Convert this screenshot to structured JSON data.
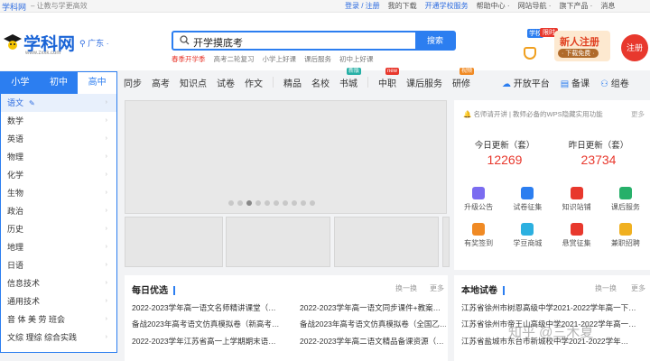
{
  "topbar": {
    "brand": "学科网",
    "slogan": "– 让教与学更高效",
    "links": [
      "登录 / 注册",
      "我的下载",
      "开通学校服务",
      "帮助中心 ·",
      "网站导航 ·",
      "旗下产品 ·",
      "消息"
    ]
  },
  "header": {
    "logo": {
      "name": "学科网",
      "sub": "www.zxxk.com"
    },
    "location": "广东 ·",
    "search": {
      "value": "开学摸底考",
      "button": "搜索"
    },
    "hotwords": [
      "春季开学季",
      "高考二轮复习",
      "小学上好课",
      "课后服务",
      "初中上好课"
    ],
    "promo": {
      "tag": "学校",
      "limited": "限时",
      "title": "新人注册",
      "subtitle": "· 下载免费 ·",
      "register": "注册"
    }
  },
  "stage_tabs": [
    "小学",
    "初中",
    "高中"
  ],
  "active_stage": "高中",
  "subjects": [
    "语文",
    "数学",
    "英语",
    "物理",
    "化学",
    "生物",
    "政治",
    "历史",
    "地理",
    "日语",
    "信息技术",
    "通用技术",
    "音 体 美 劳 班会",
    "文综 理综 综合实践"
  ],
  "nav": {
    "items": [
      {
        "label": "同步"
      },
      {
        "label": "高考"
      },
      {
        "label": "知识点"
      },
      {
        "label": "试卷"
      },
      {
        "label": "作文"
      },
      {
        "label": "精品"
      },
      {
        "label": "名校"
      },
      {
        "label": "书城",
        "badge": "新版",
        "badge_color": "#27b0a6"
      },
      {
        "label": "中职",
        "badge": "new",
        "badge_color": "#e8382d"
      },
      {
        "label": "课后服务"
      },
      {
        "label": "研修",
        "badge": "视频",
        "badge_color": "#f08a24"
      }
    ],
    "right": [
      {
        "label": "开放平台",
        "icon": "cloud-icon"
      },
      {
        "label": "备课",
        "icon": "book-icon"
      },
      {
        "label": "组卷",
        "icon": "group-icon"
      }
    ]
  },
  "side": {
    "notice": "名师请开讲 | 教师必备的WPS隐藏实用功能",
    "more": "更多",
    "stats": [
      {
        "label": "今日更新（套）",
        "value": "12269"
      },
      {
        "label": "昨日更新（套）",
        "value": "23734"
      }
    ],
    "tools": [
      {
        "label": "升级公告",
        "color": "#7b6cf0"
      },
      {
        "label": "试卷征集",
        "color": "#2c7ef0"
      },
      {
        "label": "知识站铺",
        "color": "#e8382d"
      },
      {
        "label": "课后服务",
        "color": "#27b06a"
      },
      {
        "label": "有奖签到",
        "color": "#f08a24"
      },
      {
        "label": "学豆商城",
        "color": "#2cb0e0"
      },
      {
        "label": "悬赏征集",
        "color": "#e8382d"
      },
      {
        "label": "兼职招聘",
        "color": "#f0b020"
      }
    ]
  },
  "daily": {
    "title": "每日优选",
    "action": "换一换",
    "more": "更多",
    "items": [
      "2022-2023学年高一语文名师精讲课堂（…",
      "2022-2023学年高一语文同步课件+教案…",
      "备战2023年高考语文仿真模拟卷（新高考…",
      "备战2023年高考语文仿真模拟卷（全国乙…",
      "2022-2023学年江苏省高一上学期期末语…",
      "2022-2023学年高二语文精品备课资源（…"
    ]
  },
  "local": {
    "title": "本地试卷",
    "action": "换一换",
    "more": "更多",
    "items": [
      "江苏省徐州市树恩高级中学2021-2022学年高一下…",
      "江苏省徐州市帝王山高级中学2021-2022学年高一…",
      "江苏省盐城市东台市新城校中学2021-2022学年…"
    ]
  },
  "watermark": "知乎 @三木夏"
}
